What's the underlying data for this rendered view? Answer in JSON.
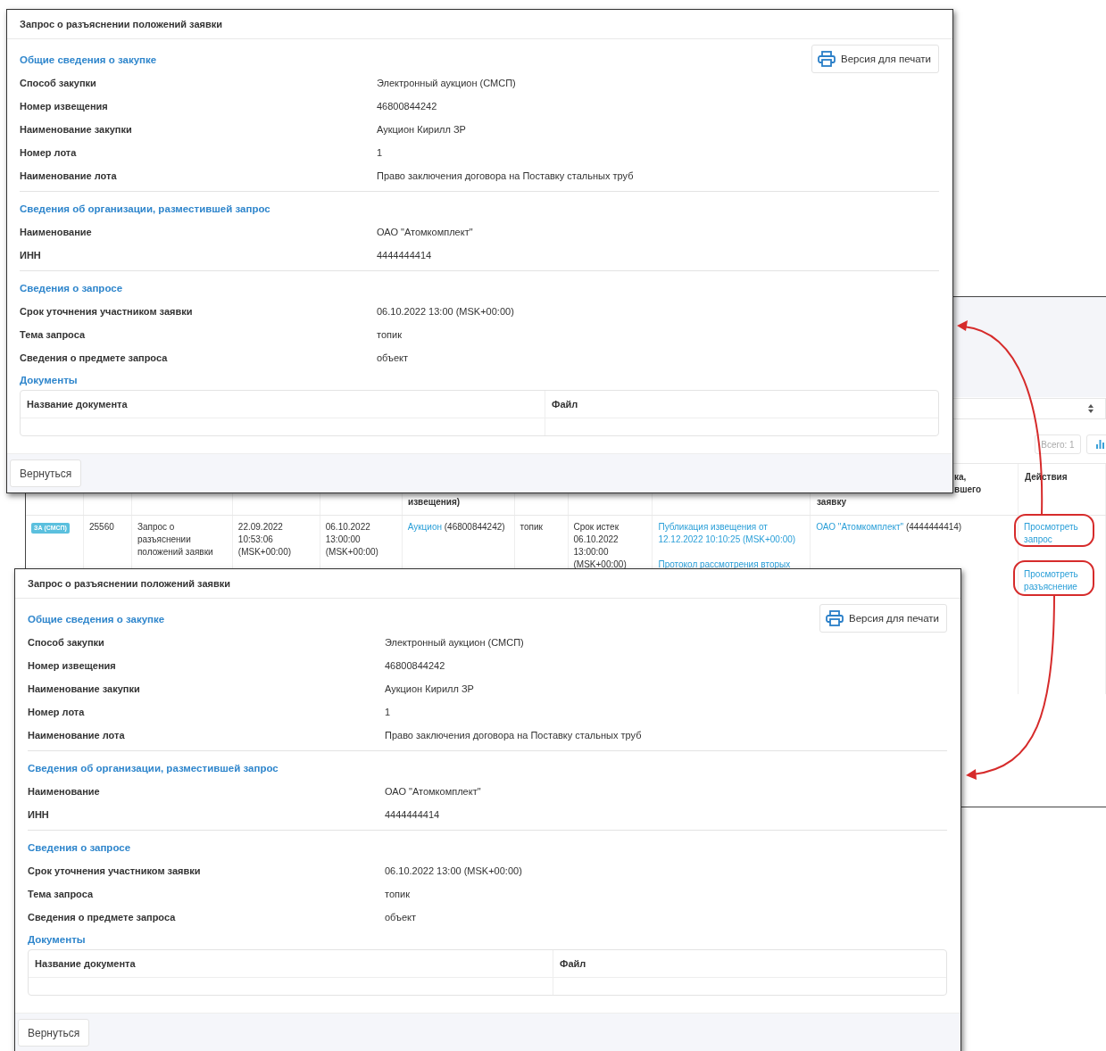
{
  "background_page": {
    "total_badge": "Всего: 1",
    "table": {
      "header": [
        {
          "text": "извещения)"
        },
        {
          "text": "ка, вшего"
        },
        {
          "text": "заявку"
        },
        {
          "text": "Действия"
        }
      ],
      "row": [
        {
          "kind": "badge",
          "text": "ЗА (СМСП)"
        },
        {
          "kind": "text",
          "text": "25560"
        },
        {
          "kind": "text",
          "text": "Запрос о разъяснении положений заявки"
        },
        {
          "kind": "text",
          "text": "22.09.2022 10:53:06 (MSK+00:00)"
        },
        {
          "kind": "text",
          "text": "06.10.2022 13:00:00 (MSK+00:00)"
        },
        {
          "kind": "link",
          "link": "Аукцион",
          "text": "(46800844242)"
        },
        {
          "kind": "text",
          "text": "топик"
        },
        {
          "kind": "text",
          "text": "Срок истек 06.10.2022 13:00:00 (MSK+00:00)"
        },
        {
          "kind": "links",
          "links": [
            "Публикация извещения от 12.12.2022 10:10:25 (MSK+00:00)",
            "Протокол рассмотрения вторых"
          ]
        },
        {
          "kind": "link",
          "link": "ОАО \"Атомкомплект\"",
          "text": "(4444444414)"
        },
        {
          "kind": "actions",
          "links": [
            "Просмотреть запрос",
            "Просмотреть разъяснение"
          ]
        }
      ]
    }
  },
  "dialogs": [
    {
      "title": "Запрос о разъяснении положений заявки",
      "print_button": "Версия для печати",
      "sections": [
        {
          "title": "Общие сведения о закупке",
          "fields": [
            {
              "label": "Способ закупки",
              "value": "Электронный аукцион (СМСП)"
            },
            {
              "label": "Номер извещения",
              "value": "46800844242"
            },
            {
              "label": "Наименование закупки",
              "value": "Аукцион Кирилл ЗР"
            },
            {
              "label": "Номер лота",
              "value": "1"
            },
            {
              "label": "Наименование лота",
              "value": "Право заключения договора на Поставку стальных труб"
            }
          ]
        },
        {
          "title": "Сведения об организации, разместившей запрос",
          "fields": [
            {
              "label": "Наименование",
              "value": "ОАО \"Атомкомплект\""
            },
            {
              "label": "ИНН",
              "value": "4444444414"
            }
          ]
        },
        {
          "title": "Сведения о запросе",
          "fields": [
            {
              "label": "Срок уточнения участником заявки",
              "value": "06.10.2022 13:00 (MSK+00:00)"
            },
            {
              "label": "Тема запроса",
              "value": "топик"
            },
            {
              "label": "Сведения о предмете запроса",
              "value": "объект"
            }
          ]
        }
      ],
      "documents": {
        "title": "Документы",
        "columns": [
          "Название документа",
          "Файл"
        ]
      },
      "back_button": "Вернуться"
    },
    {
      "title": "Запрос о разъяснении положений заявки",
      "print_button": "Версия для печати",
      "sections": [
        {
          "title": "Общие сведения о закупке",
          "fields": [
            {
              "label": "Способ закупки",
              "value": "Электронный аукцион (СМСП)"
            },
            {
              "label": "Номер извещения",
              "value": "46800844242"
            },
            {
              "label": "Наименование закупки",
              "value": "Аукцион Кирилл ЗР"
            },
            {
              "label": "Номер лота",
              "value": "1"
            },
            {
              "label": "Наименование лота",
              "value": "Право заключения договора на Поставку стальных труб"
            }
          ]
        },
        {
          "title": "Сведения об организации, разместившей запрос",
          "fields": [
            {
              "label": "Наименование",
              "value": "ОАО \"Атомкомплект\""
            },
            {
              "label": "ИНН",
              "value": "4444444414"
            }
          ]
        },
        {
          "title": "Сведения о запросе",
          "fields": [
            {
              "label": "Срок уточнения участником заявки",
              "value": "06.10.2022 13:00 (MSK+00:00)"
            },
            {
              "label": "Тема запроса",
              "value": "топик"
            },
            {
              "label": "Сведения о предмете запроса",
              "value": "объект"
            }
          ]
        }
      ],
      "documents": {
        "title": "Документы",
        "columns": [
          "Название документа",
          "Файл"
        ]
      },
      "back_button": "Вернуться"
    }
  ]
}
